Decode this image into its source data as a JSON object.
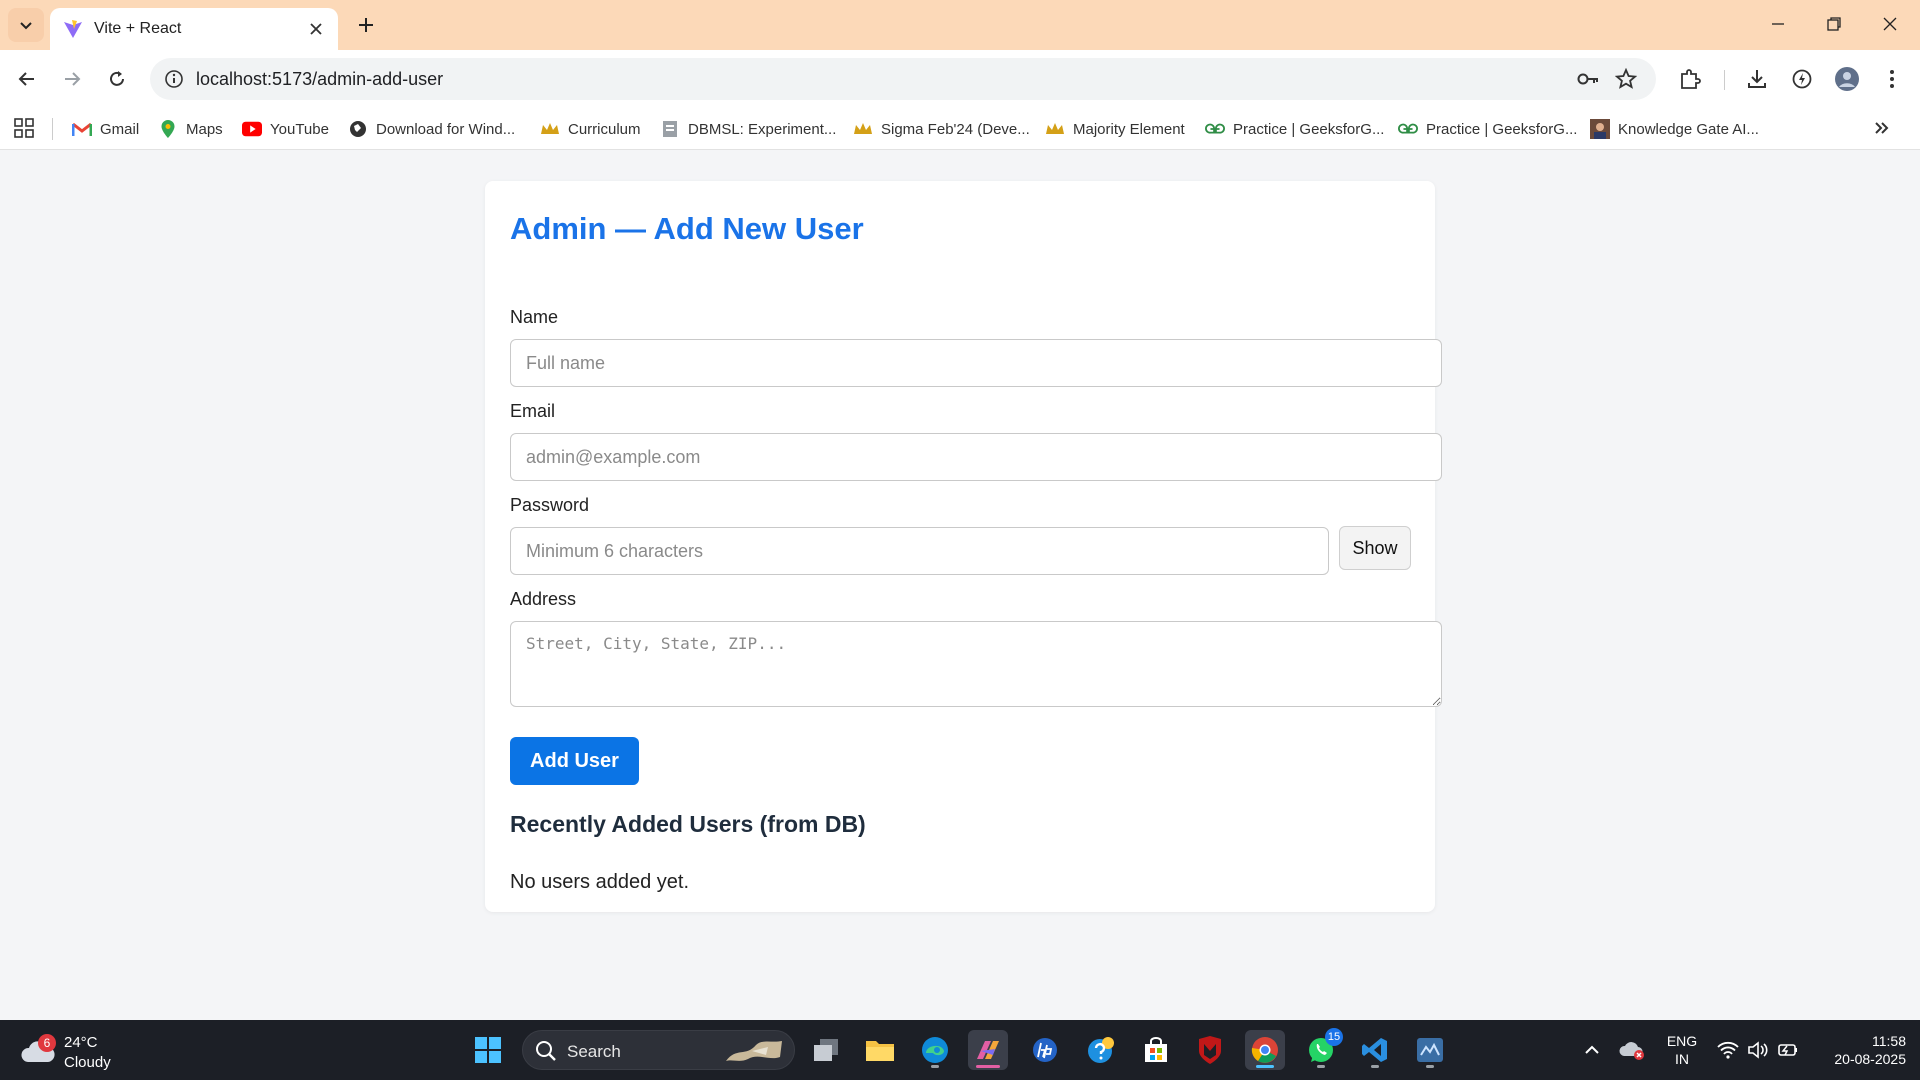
{
  "browser": {
    "tab_title": "Vite + React",
    "url": "localhost:5173/admin-add-user",
    "bookmarks": [
      {
        "label": "Gmail",
        "icon": "gmail-icon"
      },
      {
        "label": "Maps",
        "icon": "maps-icon"
      },
      {
        "label": "YouTube",
        "icon": "youtube-icon"
      },
      {
        "label": "Download for Wind...",
        "icon": "globe-icon"
      },
      {
        "label": "Curriculum",
        "icon": "crown-icon"
      },
      {
        "label": "DBMSL: Experiment...",
        "icon": "doc-icon"
      },
      {
        "label": "Sigma Feb'24 (Deve...",
        "icon": "crown-icon"
      },
      {
        "label": "Majority Element",
        "icon": "crown-icon"
      },
      {
        "label": "Practice | GeeksforG...",
        "icon": "gfg-icon"
      },
      {
        "label": "Practice | GeeksforG...",
        "icon": "gfg-icon"
      },
      {
        "label": "Knowledge Gate AI...",
        "icon": "avatar-icon"
      }
    ]
  },
  "form": {
    "title": "Admin — Add New User",
    "name_label": "Name",
    "name_placeholder": "Full name",
    "email_label": "Email",
    "email_placeholder": "admin@example.com",
    "password_label": "Password",
    "password_placeholder": "Minimum 6 characters",
    "show_label": "Show",
    "address_label": "Address",
    "address_placeholder": "Street, City, State, ZIP...",
    "submit_label": "Add User"
  },
  "recent": {
    "title": "Recently Added Users (from DB)",
    "empty": "No users added yet."
  },
  "taskbar": {
    "weather_temp": "24°C",
    "weather_cond": "Cloudy",
    "weather_badge": "6",
    "search_label": "Search",
    "whatsapp_badge": "15",
    "lang_top": "ENG",
    "lang_bottom": "IN",
    "time": "11:58",
    "date": "20-08-2025"
  },
  "colors": {
    "accent": "#1a73e8",
    "tabstrip": "#fcd9b8",
    "button": "#0b74e5",
    "taskbar": "#1c1f26"
  }
}
